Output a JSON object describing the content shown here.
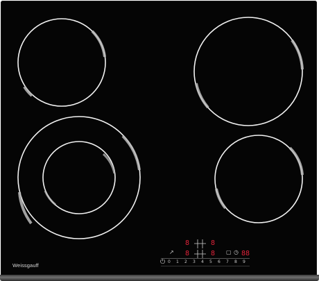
{
  "brand": "Weissgauff",
  "controls": {
    "display_top_left": "8",
    "display_top_right": "8",
    "display_mid_left": "8",
    "display_mid_right": "8",
    "timer_display": "88",
    "power_symbol": "⏻",
    "lock_symbol": "↗",
    "timer_symbol": "◷",
    "box_symbol": "▢",
    "slider_levels": [
      "0",
      "1",
      "2",
      "3",
      "4",
      "5",
      "6",
      "7",
      "8",
      "9"
    ]
  },
  "colors": {
    "glass": "#050505",
    "zone_ring": "#ffffff",
    "display": "#e0233a"
  },
  "icons": {
    "power": "power-icon",
    "lock": "lock-icon",
    "timer": "timer-icon"
  }
}
